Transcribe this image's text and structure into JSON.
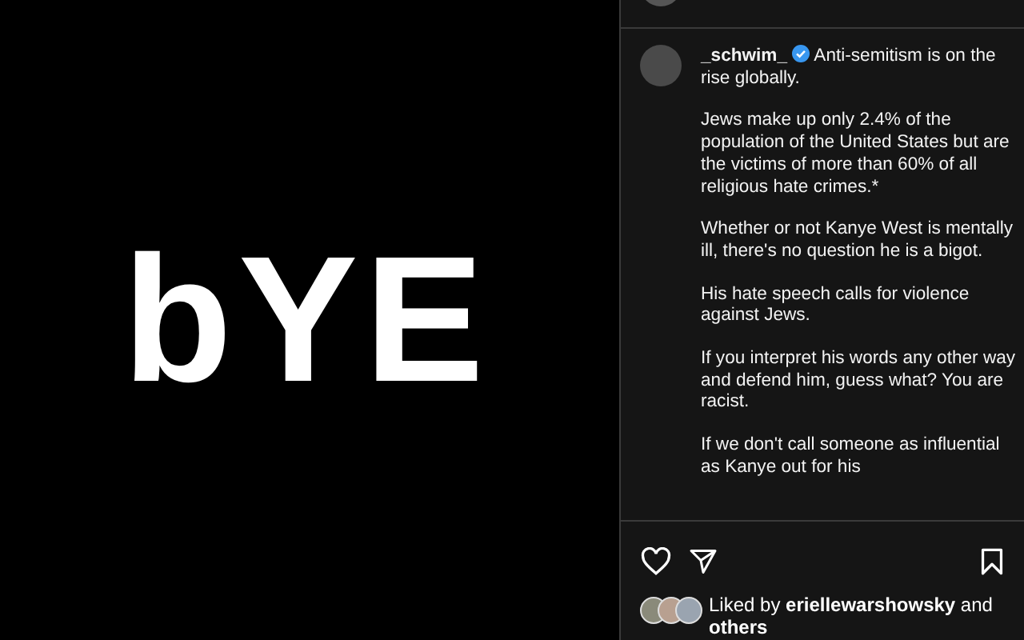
{
  "post_image": {
    "text": "bYE"
  },
  "post": {
    "username": "_schwim_",
    "verified": true,
    "caption": [
      "Anti-semitism is on the rise globally.",
      "Jews make up only 2.4% of the population of the United States but are the victims of more than 60% of all religious hate crimes.*",
      "Whether or not Kanye West is mentally ill, there's no question he is a bigot.",
      "His hate speech calls for violence against Jews.",
      "If you interpret his words any other way and defend him, guess what? You are racist.",
      "If we don't call someone as influential as Kanye out for his"
    ],
    "liked_by": {
      "prefix": "Liked by",
      "user": "eriellewarshowsky",
      "suffix": "and",
      "rest": "others"
    }
  }
}
